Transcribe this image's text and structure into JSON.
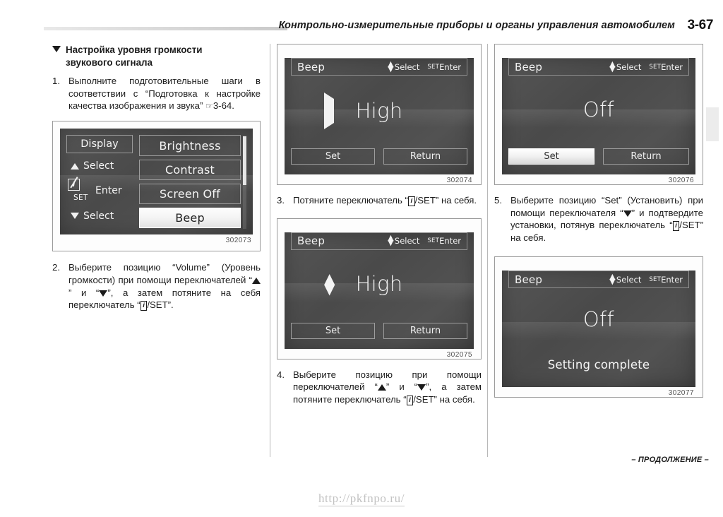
{
  "header": {
    "title": "Контрольно-измерительные приборы и органы управления автомобилем",
    "page_number": "3-67"
  },
  "section": {
    "heading_line1": "Настройка уровня громкости",
    "heading_line2": "звукового сигнала"
  },
  "steps": {
    "s1": {
      "num": "1.",
      "text": "Выполните подготовительные шаги в соответствии с “Подготовка к настройке качества изображения и звука”",
      "ref": "3-64."
    },
    "s2": {
      "num": "2.",
      "t1": "Выберите позицию “Volume” (Уровень громкости) при помощи переключателей “",
      "t2": "” и “",
      "t3": "”, а затем потяните на себя переключатель “",
      "i_label": "i",
      "t4": "/SET”."
    },
    "s3": {
      "num": "3.",
      "t1": "Потяните переключатель “",
      "i_label": "i",
      "t2": "/SET” на себя."
    },
    "s4": {
      "num": "4.",
      "t1": "Выберите позицию при помощи переключателей “",
      "t2": "” и “",
      "t3": "”, а затем потяните переключатель “",
      "i_label": "i",
      "t4": "/SET” на себя."
    },
    "s5": {
      "num": "5.",
      "t1": "Выберите позицию “Set” (Установить) при помощи переключателя “",
      "t2": "” и подтвердите установки, потянув переключатель “",
      "i_label": "i",
      "t3": "/SET” на себя."
    }
  },
  "figures": {
    "menu": {
      "code": "302073",
      "left_panel": {
        "display_label": "Display",
        "select_up_label": "Select",
        "enter_label": "Enter",
        "info_icon_label": "i",
        "set_label": "SET",
        "select_down_label": "Select"
      },
      "items": [
        {
          "label": "Brightness",
          "selected": false
        },
        {
          "label": "Contrast",
          "selected": false
        },
        {
          "label": "Screen Off",
          "selected": false
        },
        {
          "label": "Beep",
          "selected": true
        }
      ]
    },
    "beep_high_pointer": {
      "code": "302074",
      "title": "Beep",
      "hint_select": "Select",
      "hint_set": "SET",
      "hint_enter": "Enter",
      "value": "High",
      "marker": "pointer-right",
      "btn_set": "Set",
      "btn_return": "Return",
      "active_button": "none"
    },
    "beep_high_updown": {
      "code": "302075",
      "title": "Beep",
      "hint_select": "Select",
      "hint_set": "SET",
      "hint_enter": "Enter",
      "value": "High",
      "marker": "up-down",
      "btn_set": "Set",
      "btn_return": "Return",
      "active_button": "none"
    },
    "beep_off_set": {
      "code": "302076",
      "title": "Beep",
      "hint_select": "Select",
      "hint_set": "SET",
      "hint_enter": "Enter",
      "value": "Off",
      "marker": "none",
      "btn_set": "Set",
      "btn_return": "Return",
      "active_button": "set"
    },
    "beep_off_complete": {
      "code": "302077",
      "title": "Beep",
      "hint_select": "Select",
      "hint_set": "SET",
      "hint_enter": "Enter",
      "value": "Off",
      "message": "Setting complete"
    }
  },
  "footer": {
    "continued": "– ПРОДОЛЖЕНИЕ –",
    "watermark": "http://pkfnpo.ru/"
  },
  "colors": {
    "lcd_background": "#4e4e4e",
    "lcd_text": "#f4f4f4",
    "selected_item": "#f4f4f4",
    "page_background": "#ffffff"
  }
}
